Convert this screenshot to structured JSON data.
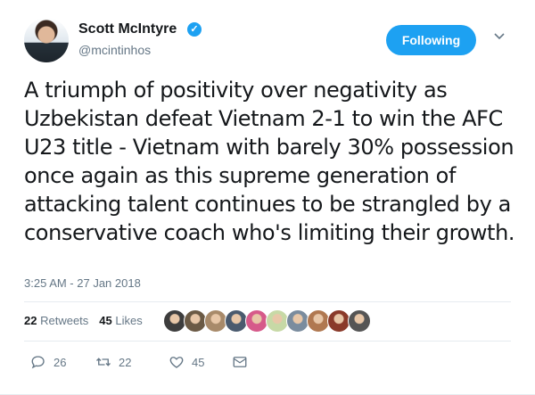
{
  "author": {
    "name": "Scott McIntyre",
    "handle": "@mcintinhos",
    "verified_icon": "verified-check-icon"
  },
  "follow_button": {
    "label": "Following"
  },
  "menu": {
    "icon": "chevron-down-icon"
  },
  "tweet": {
    "text": "A triumph of positivity over negativity as Uzbekistan defeat Vietnam 2-1 to win the AFC U23 title - Vietnam with barely 30% possession once again as this supreme generation of attacking talent continues to be strangled by a conservative coach who's limiting their growth.",
    "timestamp": "3:25 AM - 27 Jan 2018"
  },
  "stats": {
    "retweets_count": "22",
    "retweets_label": "Retweets",
    "likes_count": "45",
    "likes_label": "Likes"
  },
  "likers": [
    {
      "color": "#3d3d3d"
    },
    {
      "color": "#6b5a45"
    },
    {
      "color": "#a88a6a"
    },
    {
      "color": "#4a5a6e"
    },
    {
      "color": "#d65a8a"
    },
    {
      "color": "#c7d9a6"
    },
    {
      "color": "#7a8c9e"
    },
    {
      "color": "#b07850"
    },
    {
      "color": "#8a3a2a"
    },
    {
      "color": "#555555"
    }
  ],
  "actions": {
    "reply": {
      "count": "26",
      "icon": "reply-icon"
    },
    "retweet": {
      "count": "22",
      "icon": "retweet-icon"
    },
    "like": {
      "count": "45",
      "icon": "heart-icon"
    },
    "message": {
      "icon": "envelope-icon"
    }
  },
  "colors": {
    "accent": "#1da1f2",
    "secondary_text": "#657786",
    "text": "#14171a"
  }
}
